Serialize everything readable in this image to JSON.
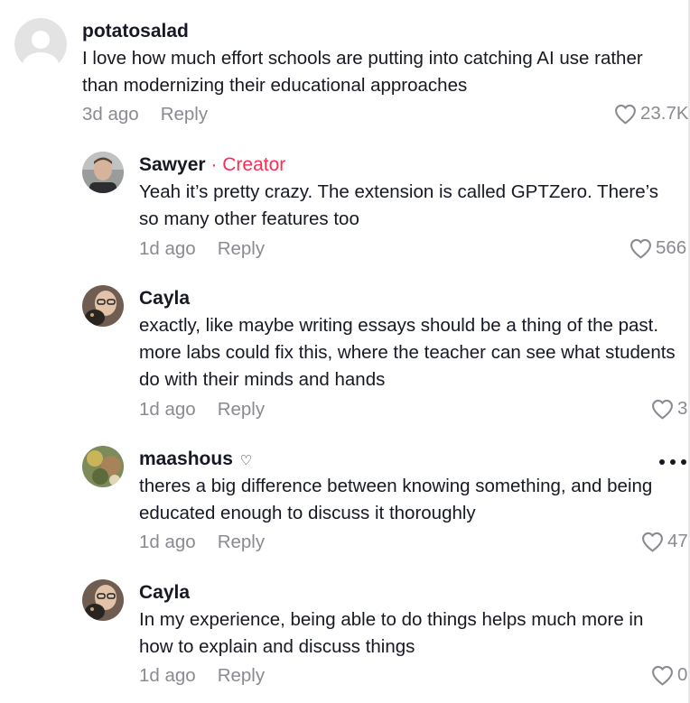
{
  "comments": [
    {
      "username": "potatosalad",
      "text": "I love how much effort schools are putting into catching AI use rather than modernizing their educational approaches",
      "time": "3d ago",
      "reply_label": "Reply",
      "likes": "23.7K"
    },
    {
      "username": "Sawyer",
      "creator_tag": "· Creator",
      "text": "Yeah it’s pretty crazy. The extension is called GPTZero. There’s so many other features too",
      "time": "1d ago",
      "reply_label": "Reply",
      "likes": "566"
    },
    {
      "username": "Cayla",
      "text": "exactly, like maybe writing essays should be a thing of the past. more labs could fix this, where the teacher can see what students do with their minds and hands",
      "time": "1d ago",
      "reply_label": "Reply",
      "likes": "3"
    },
    {
      "username": "maashous",
      "username_suffix": "♡",
      "text": "theres a big difference between knowing something, and being educated enough to discuss it thoroughly",
      "time": "1d ago",
      "reply_label": "Reply",
      "likes": "47"
    },
    {
      "username": "Cayla",
      "text": "In my experience, being able to do things helps much more in how to explain and discuss things",
      "time": "1d ago",
      "reply_label": "Reply",
      "likes": "0"
    }
  ],
  "icons": {
    "like": "heart-outline-icon",
    "more": "more-options-icon",
    "avatar_default": "default-avatar-icon"
  },
  "colors": {
    "primary_text": "#161823",
    "secondary_text": "#8a8b91",
    "creator_accent": "#fe2c55"
  }
}
